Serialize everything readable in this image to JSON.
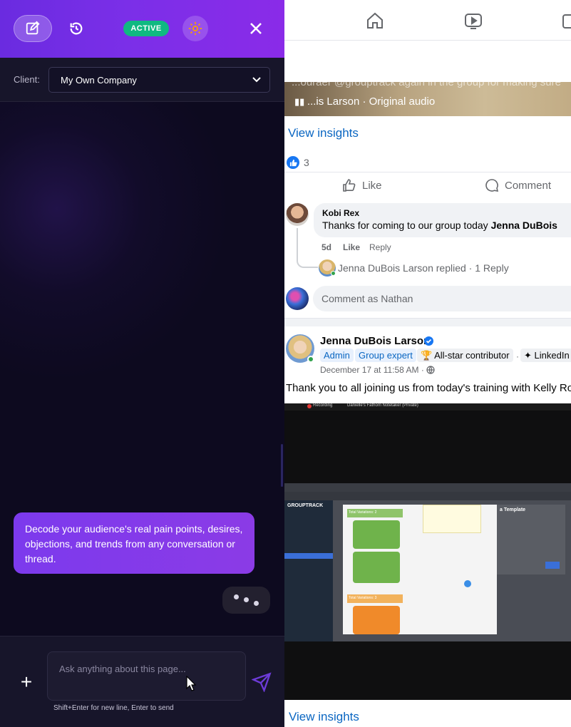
{
  "panel": {
    "status_badge": "ACTIVE",
    "client_label": "Client:",
    "client_value": "My Own Company",
    "bot_message": "Decode your audience's real pain points, desires, objections, and trends from any conversation or thread.",
    "input_placeholder": "Ask anything about this page...",
    "input_hint": "Shift+Enter for new line, Enter to send",
    "plus_label": "+"
  },
  "feed": {
    "reel_top_text": "...ouraer @grouptrack again in the group for making sure",
    "reel_audio": "...is Larson · Original audio",
    "view_insights": "View insights",
    "reaction_count": "3",
    "like_label": "Like",
    "comment_label": "Comment",
    "comment": {
      "author": "Kobi Rex",
      "text_prefix": "Thanks for coming to our group today ",
      "text_bold": "Jenna DuBois",
      "time": "5d",
      "like": "Like",
      "reply": "Reply",
      "replies_link": "Jenna DuBois Larson replied · 1 Reply"
    },
    "comment_as": "Comment as Nathan",
    "post": {
      "author": "Jenna DuBois Larson",
      "badges": [
        "Admin",
        "Group expert",
        "All-star contributor",
        "LinkedIn"
      ],
      "time": "December 17 at 11:58 AM ·",
      "text": "Thank you to all joining us from today's training with Kelly Ro"
    },
    "video": {
      "recording": "Recording",
      "notetaker": "Danielle's Fathom Notetaker (Private)",
      "app_title": "GROUPTRACK",
      "modal_title": "a Template",
      "card_heading_1": "Total Variations: 2",
      "card_heading_2": "Total Variations: 3"
    }
  },
  "colors": {
    "header_purple": "#7b2fe8",
    "active_green": "#10b981",
    "fb_blue": "#1877f2",
    "link_blue": "#0a66c2",
    "panel_bg": "#0d0a1f"
  },
  "icons": [
    "edit-icon",
    "history-icon",
    "gear-icon",
    "close-icon",
    "plus-icon",
    "send-icon",
    "home-icon",
    "video-icon",
    "thumbs-up-icon",
    "comment-icon",
    "globe-icon",
    "trophy-icon",
    "sparkle-icon"
  ]
}
